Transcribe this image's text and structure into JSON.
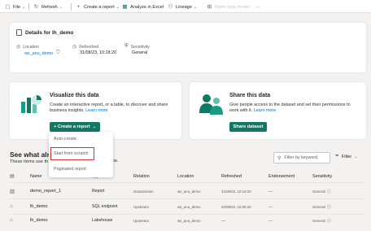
{
  "toolbar": {
    "file": "File",
    "refresh": "Refresh",
    "create_report": "Create a report",
    "analyze": "Analyze in Excel",
    "lineage": "Lineage",
    "open_model": "Open data model"
  },
  "details": {
    "title": "Details for lh_demo",
    "location_label": "Location",
    "location_value": "ws_anu_demo",
    "refreshed_label": "Refreshed",
    "refreshed_value": "31/08/23, 10:18:20",
    "sensitivity_label": "Sensitivity",
    "sensitivity_value": "General"
  },
  "visualize": {
    "title": "Visualize this data",
    "description": "Create an interactive report, or a table, to discover and share business insights. Learn more",
    "line1": "Create an interactive report, or a table, to discover and share",
    "line2": "business insights.",
    "learn_more": "Learn more",
    "button": "+ Create a report"
  },
  "menu": {
    "items": [
      "Auto-create",
      "Start from scratch",
      "Paginated report"
    ]
  },
  "share": {
    "title": "Share this data",
    "line1": "Give people access to the dataset and set their permissions to",
    "line2": "work with it.",
    "learn_more": "Learn more",
    "button": "Share dataset"
  },
  "related": {
    "title_left": "See what alrea",
    "title_right": "emo.",
    "subtitle_left": "These items use th",
    "search_placeholder": "Filter by keyword",
    "filter_label": "Filter"
  },
  "table": {
    "headers": [
      "Name",
      "Type",
      "Relation",
      "Location",
      "Refreshed",
      "Endorsement",
      "Sensitivity"
    ],
    "rows": [
      {
        "name": "demo_report_1",
        "type": "Report",
        "relation": "Downstream",
        "location": "ws_anu_demo",
        "refreshed": "31/08/23, 10:18:20",
        "endorsement": "—",
        "sensitivity": "General"
      },
      {
        "name": "lh_demo",
        "type": "SQL endpoint",
        "relation": "Upstream",
        "location": "ws_anu_demo",
        "refreshed": "02/09/23, 16:36:20",
        "endorsement": "—",
        "sensitivity": "General"
      },
      {
        "name": "lh_demo",
        "type": "Lakehouse",
        "relation": "Upstream",
        "location": "ws_anu_demo",
        "refreshed": "—",
        "endorsement": "—",
        "sensitivity": "General"
      }
    ]
  },
  "colors": {
    "accent_green": "#117865",
    "link_blue": "#0f6cbd",
    "highlight_red": "#d13438"
  }
}
